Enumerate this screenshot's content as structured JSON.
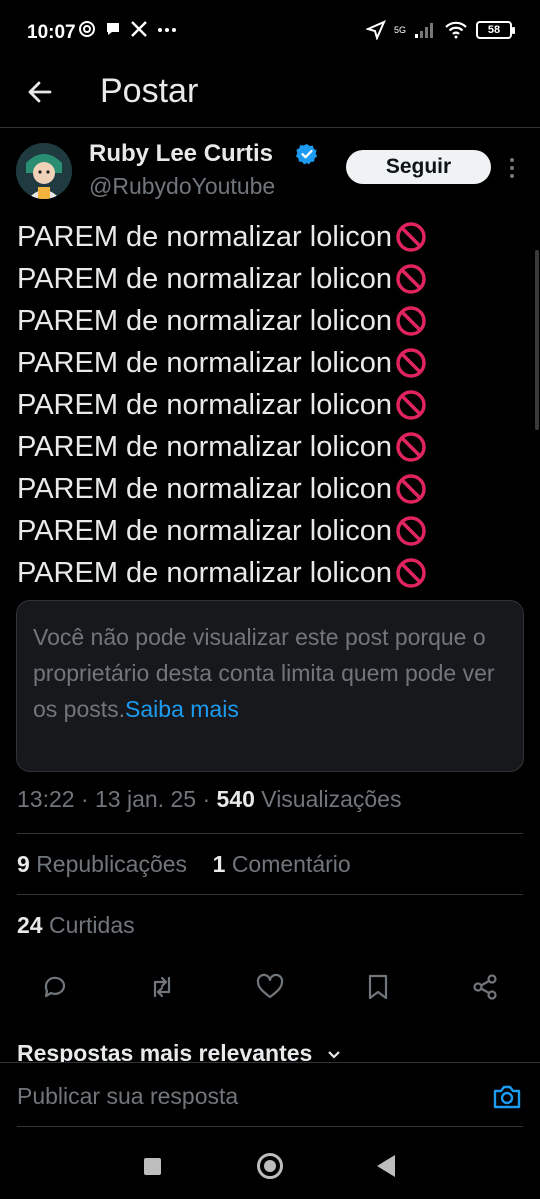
{
  "status_bar": {
    "time": "10:07",
    "network": "5G",
    "battery": "58"
  },
  "header": {
    "title": "Postar"
  },
  "post": {
    "author_name": "Ruby Lee Curtis",
    "author_handle": "@RubydoYoutube",
    "follow_label": "Seguir",
    "lines": [
      "PAREM de normalizar lolicon",
      "PAREM de normalizar lolicon",
      "PAREM de normalizar lolicon",
      "PAREM de normalizar lolicon",
      "PAREM de normalizar lolicon",
      "PAREM de normalizar lolicon",
      "PAREM de normalizar lolicon",
      "PAREM de normalizar lolicon",
      "PAREM de normalizar lolicon"
    ],
    "quote_notice": "Você não pode visualizar este post porque o proprietário desta conta limita quem pode ver os posts.",
    "quote_link": "Saiba mais",
    "time": "13:22",
    "date": "13 jan. 25",
    "views_count": "540",
    "views_label": "Visualizações",
    "reposts_count": "9",
    "reposts_label": "Republicações",
    "comments_count": "1",
    "comments_label": "Comentário",
    "likes_count": "24",
    "likes_label": "Curtidas"
  },
  "replies": {
    "heading": "Respostas mais relevantes",
    "input_placeholder": "Publicar sua resposta"
  },
  "colors": {
    "background": "#000000",
    "text": "#e7e9ea",
    "muted": "#71767b",
    "accent": "#1d9bf0",
    "divider": "#2f3336",
    "prohibited": "#e0245e"
  },
  "icons": [
    "back-arrow-icon",
    "verified-badge-icon",
    "more-vertical-icon",
    "prohibited-icon",
    "reply-icon",
    "repost-icon",
    "like-icon",
    "bookmark-icon",
    "share-icon",
    "camera-icon"
  ]
}
